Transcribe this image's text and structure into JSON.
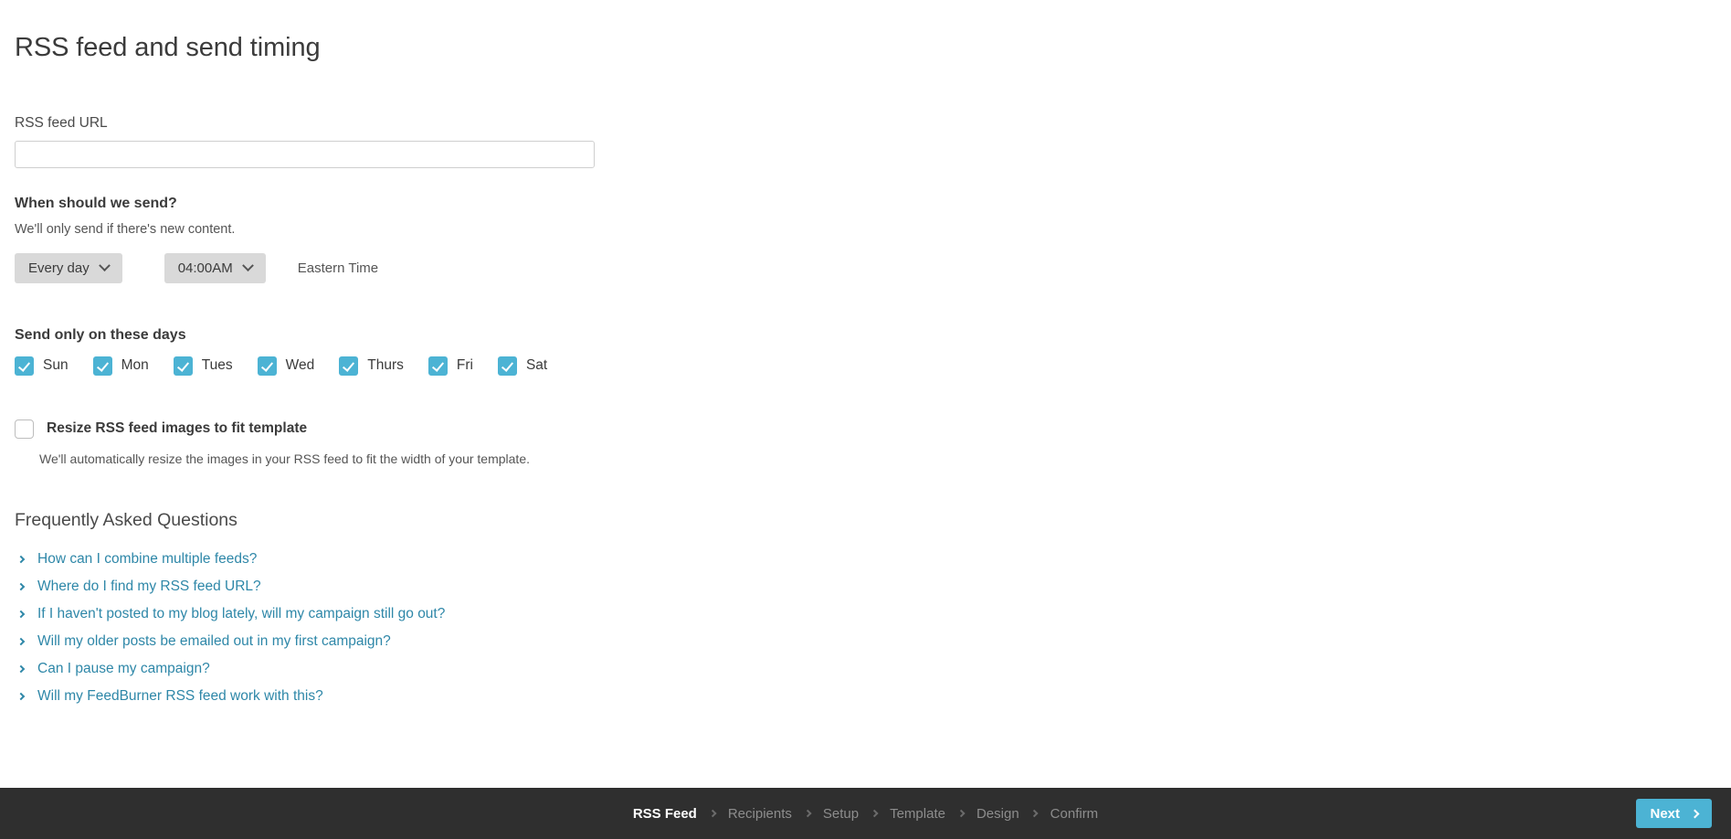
{
  "page": {
    "title": "RSS feed and send timing"
  },
  "rss_feed_url": {
    "label": "RSS feed URL",
    "value": "",
    "placeholder": ""
  },
  "when_to_send": {
    "heading": "When should we send?",
    "subtext": "We'll only send if there's new content.",
    "frequency_selected": "Every day",
    "time_selected": "04:00AM",
    "timezone_label": "Eastern Time"
  },
  "send_days": {
    "heading": "Send only on these days",
    "days": [
      {
        "label": "Sun",
        "checked": true
      },
      {
        "label": "Mon",
        "checked": true
      },
      {
        "label": "Tues",
        "checked": true
      },
      {
        "label": "Wed",
        "checked": true
      },
      {
        "label": "Thurs",
        "checked": true
      },
      {
        "label": "Fri",
        "checked": true
      },
      {
        "label": "Sat",
        "checked": true
      }
    ]
  },
  "resize_option": {
    "label": "Resize RSS feed images to fit template",
    "checked": false,
    "description": "We'll automatically resize the images in your RSS feed to fit the width of your template."
  },
  "faq": {
    "heading": "Frequently Asked Questions",
    "items": [
      {
        "text": "How can I combine multiple feeds?"
      },
      {
        "text": "Where do I find my RSS feed URL?"
      },
      {
        "text": "If I haven't posted to my blog lately, will my campaign still go out?"
      },
      {
        "text": "Will my older posts be emailed out in my first campaign?"
      },
      {
        "text": "Can I pause my campaign?"
      },
      {
        "text": "Will my FeedBurner RSS feed work with this?"
      }
    ]
  },
  "footer": {
    "steps": [
      {
        "label": "RSS Feed",
        "active": true
      },
      {
        "label": "Recipients",
        "active": false
      },
      {
        "label": "Setup",
        "active": false
      },
      {
        "label": "Template",
        "active": false
      },
      {
        "label": "Design",
        "active": false
      },
      {
        "label": "Confirm",
        "active": false
      }
    ],
    "next_label": "Next"
  },
  "colors": {
    "accent": "#4cb3d4",
    "link": "#2e87a8",
    "footer_bg": "#2f2f2f",
    "dropdown_bg": "#d9d9d9",
    "text": "#3b3b3b"
  }
}
